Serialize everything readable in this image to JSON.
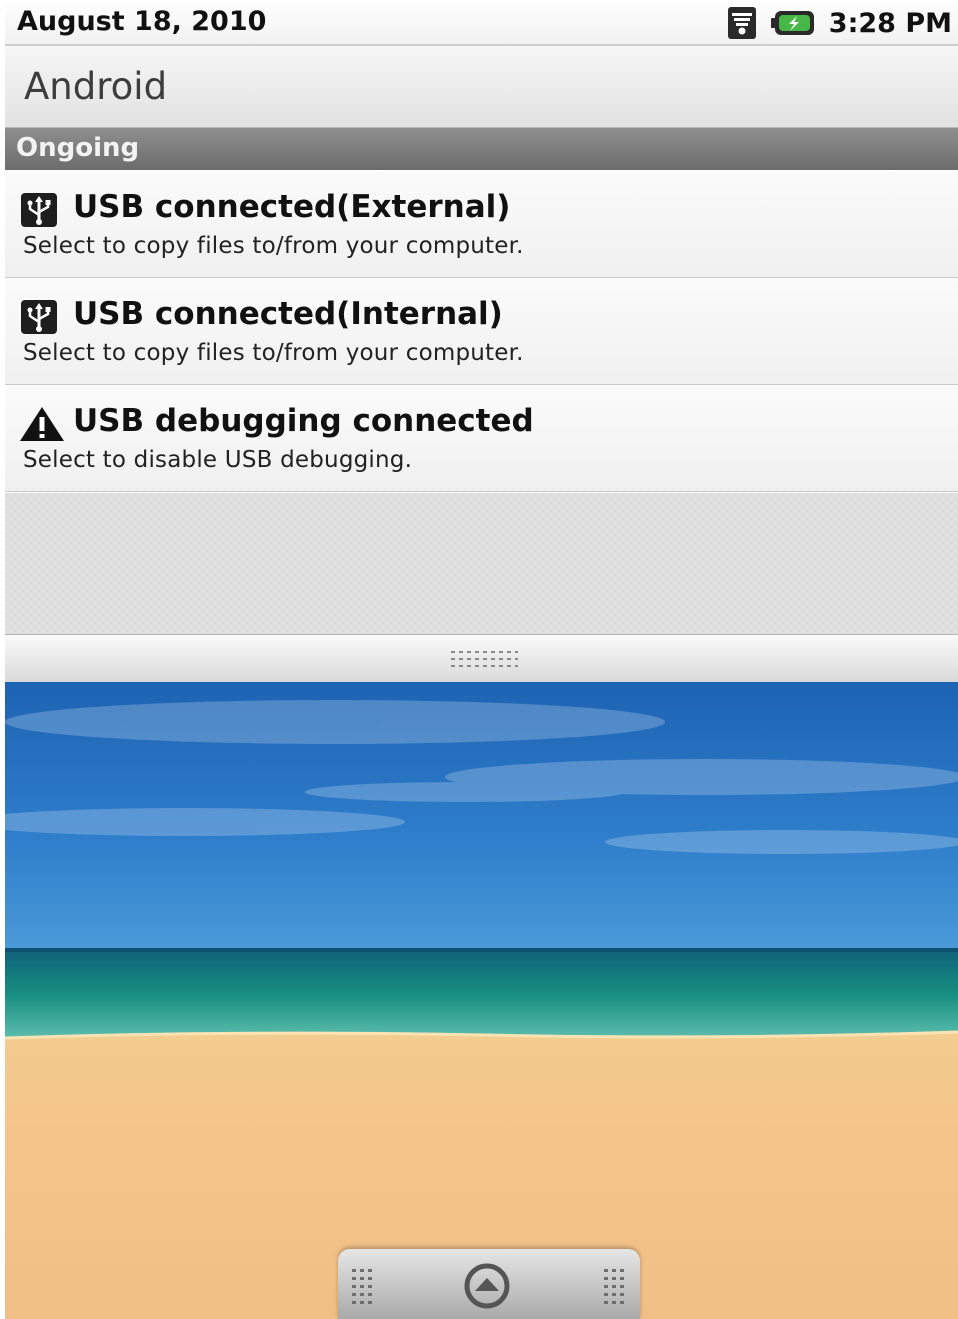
{
  "status_bar": {
    "date": "August 18, 2010",
    "time": "3:28 PM",
    "icons": [
      "wifi-icon",
      "battery-charging-icon"
    ]
  },
  "panel": {
    "title": "Android"
  },
  "sections": {
    "ongoing_label": "Ongoing"
  },
  "notifications": [
    {
      "icon": "usb-icon",
      "title": "USB connected(External)",
      "text": "Select to copy files to/from your computer."
    },
    {
      "icon": "usb-icon",
      "title": "USB connected(Internal)",
      "text": "Select to copy files to/from your computer."
    },
    {
      "icon": "warning-icon",
      "title": "USB debugging connected",
      "text": "Select to disable USB debugging."
    }
  ],
  "handle": {
    "icon": "grip-icon"
  },
  "launcher": {
    "icons": [
      "grip-icon",
      "launcher-up-arrow-icon",
      "grip-icon"
    ]
  },
  "colors": {
    "section_header": "#7d7d7d",
    "sky": "#2c75c0",
    "sea": "#1a8a7c",
    "sand": "#f2c58e"
  }
}
